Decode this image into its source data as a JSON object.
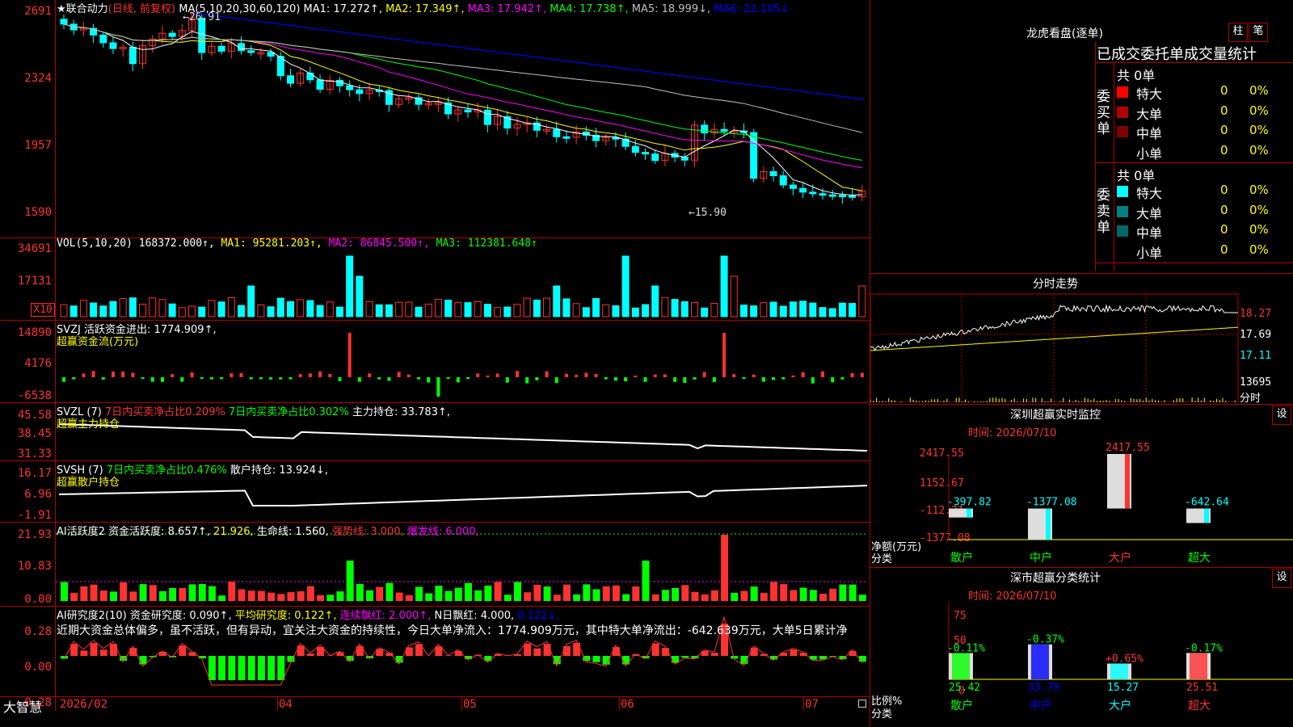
{
  "left_axis": {
    "price": [
      "2691",
      "2324",
      "1957",
      "1590"
    ],
    "vol": [
      "34691",
      "17131"
    ],
    "vol_unit": "X10",
    "svzj": [
      "14890",
      "4176",
      "-6538"
    ],
    "svzl": [
      "45.58",
      "38.45",
      "31.33"
    ],
    "svsh": [
      "16.17",
      "6.96",
      "-1.91"
    ],
    "ai1": [
      "21.93",
      "10.83",
      "0.00"
    ],
    "ai2": [
      "0.28",
      "0.00",
      "-0.28"
    ]
  },
  "main_header": {
    "star": "★",
    "name": "联合动力",
    "period": "(日线, 前复权)",
    "ma": "MA(5,10,20,30,60,120)",
    "ma1": "MA1: 17.272↑,",
    "ma2": "MA2: 17.349↑,",
    "ma3": "MA3: 17.942↑,",
    "ma4": "MA4: 17.738↑,",
    "ma5": "MA5: 18.999↓,",
    "ma6": "MA6: 22.105↓",
    "high_label": "←26.91",
    "low_label": "←15.90"
  },
  "vol_header": {
    "name": "VOL(5,10,20)",
    "val": "168372.000↑,",
    "ma1": "MA1: 95281.203↑,",
    "ma2": "MA2: 86845.500↑,",
    "ma3": "MA3: 112381.648↑"
  },
  "svzj_header": {
    "name": "SVZJ",
    "text": "活跃资金进出: 1774.909↑,",
    "sub": "超赢资金流(万元)"
  },
  "svzl_header": {
    "name": "SVZL (7)",
    "a": "7日内买卖净占比0.209%",
    "b": "7日内买卖净占比0.302%",
    "c": "主力持仓: 33.783↑,",
    "sub": "超赢主力持仓"
  },
  "svsh_header": {
    "name": "SVSH (7)",
    "a": "7日内买卖净占比0.476%",
    "b": "散户持仓: 13.924↓,",
    "sub": "超赢散户持仓"
  },
  "ai1_header": {
    "name": "AI活跃度2",
    "a": "资金活跃度: 8.657↑,",
    "b": "21.926,",
    "c": "生命线: 1.560,",
    "d": "强势线: 3.000,",
    "e": "爆发线: 6.000,"
  },
  "ai2_header": {
    "name": "AI研究度2(10)",
    "a": "资金研究度: 0.090↑,",
    "b": "平均研究度: 0.122↑,",
    "c": "连续飘红: 2.000↑,",
    "d": "N日飘红: 4.000,",
    "e": "0.122↓,",
    "comment": "近期大资金总体偏多，虽不活跃，但有异动，宜关注大资金的持续性，今日大单净流入：1774.909万元，其中特大单净流出：-642.639万元，大单5日累计净"
  },
  "bottom_bar": {
    "brand": "大智慧",
    "dates": [
      "2026/02",
      "04",
      "05",
      "06",
      "07"
    ]
  },
  "right": {
    "lhb_title": "龙虎看盘(逐单)",
    "btn_bar": "柱",
    "btn_pen": "笔",
    "tabs": "已成交委托单成交量统计",
    "buy_side": "委买单",
    "sell_side": "委卖单",
    "buy_total": "共 0单",
    "sell_total": "共 0单",
    "buy_rows": [
      {
        "label": "特大",
        "val": "0",
        "pct": "0%",
        "color": "#ff0000"
      },
      {
        "label": "大单",
        "val": "0",
        "pct": "0%",
        "color": "#b00000"
      },
      {
        "label": "中单",
        "val": "0",
        "pct": "0%",
        "color": "#800000"
      },
      {
        "label": "小单",
        "val": "0",
        "pct": "0%",
        "color": ""
      }
    ],
    "sell_rows": [
      {
        "label": "特大",
        "val": "0",
        "pct": "0%",
        "color": "#00ffff"
      },
      {
        "label": "大单",
        "val": "0",
        "pct": "0%",
        "color": "#008080"
      },
      {
        "label": "中单",
        "val": "0",
        "pct": "0%",
        "color": "#006868"
      },
      {
        "label": "小单",
        "val": "0",
        "pct": "0%",
        "color": ""
      }
    ],
    "intraday_title": "分时走势",
    "intraday_axis": [
      "18.27",
      "17.69",
      "17.11",
      "13695"
    ],
    "intraday_label": "分时",
    "monitor_title": "深圳超赢实时监控",
    "monitor_btn": "设",
    "monitor_time": "时间: 2026/07/10",
    "monitor_axis": [
      "2417.55",
      "1152.67",
      "-112.21",
      "-1377.08"
    ],
    "monitor_unit1": "净额(万元)",
    "monitor_unit2": "分类",
    "monitor_bars": [
      {
        "cat": "散户",
        "val": "-397.82"
      },
      {
        "cat": "中户",
        "val": "-1377.08"
      },
      {
        "cat": "大户",
        "val": "2417.55"
      },
      {
        "cat": "超大",
        "val": "-642.64"
      }
    ],
    "class_title": "深市超赢分类统计",
    "class_btn": "设",
    "class_time": "时间: 2026/07/10",
    "class_axis": [
      "75",
      "50",
      "25",
      "0"
    ],
    "class_unit1": "比例%",
    "class_unit2": "分类",
    "class_bars": [
      {
        "cat": "散户",
        "pct": "25.42",
        "chg": "-0.11%"
      },
      {
        "cat": "中户",
        "pct": "33.79",
        "chg": "-0.37%"
      },
      {
        "cat": "大户",
        "pct": "15.27",
        "chg": "+0.65%"
      },
      {
        "cat": "超大",
        "pct": "25.51",
        "chg": "-0.17%"
      }
    ]
  }
}
